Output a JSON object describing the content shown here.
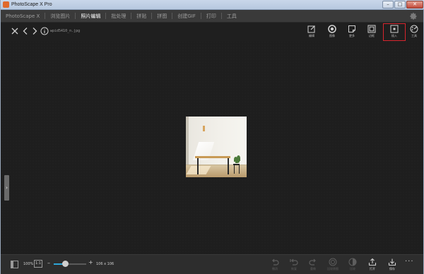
{
  "window": {
    "title": "PhotoScape X Pro",
    "controls": [
      "minimize",
      "maximize",
      "close"
    ]
  },
  "menu": {
    "items": [
      {
        "label": "PhotoScape X",
        "active": false
      },
      {
        "label": "浏览图片",
        "active": false
      },
      {
        "label": "照片编辑",
        "active": true
      },
      {
        "label": "批处理",
        "active": false
      },
      {
        "label": "拼贴",
        "active": false
      },
      {
        "label": "拼图",
        "active": false
      },
      {
        "label": "创建GIF",
        "active": false
      },
      {
        "label": "打印",
        "active": false
      },
      {
        "label": "工具",
        "active": false
      }
    ],
    "settings_icon": "gear-icon"
  },
  "toolbar": {
    "filename": "wpid5410_n.jpg",
    "tools": [
      {
        "label": "编辑",
        "icon": "edit-icon"
      },
      {
        "label": "图像",
        "icon": "filter-icon"
      },
      {
        "label": "更多",
        "icon": "more-icon"
      },
      {
        "label": "边框",
        "icon": "frame-icon"
      },
      {
        "label": "插入",
        "icon": "insert-icon"
      },
      {
        "label": "工具",
        "icon": "palette-icon"
      }
    ],
    "highlighted_tool": "插入",
    "highlight_color": "#d7252d"
  },
  "canvas": {
    "background": "#1e1e1e",
    "image_alt": "room with wooden table"
  },
  "statusbar": {
    "zoom_percent": "100%",
    "one_to_one": "1:1",
    "zoom_level": 0.35,
    "dimensions": "106 x 106",
    "accent": "#2da6d9",
    "actions": [
      {
        "label": "撤消",
        "icon": "undo-icon",
        "enabled": false
      },
      {
        "label": "恢复",
        "icon": "undo-all-icon",
        "enabled": false
      },
      {
        "label": "重做",
        "icon": "redo-icon",
        "enabled": false
      },
      {
        "label": "比较原图",
        "icon": "compare-icon",
        "enabled": false
      },
      {
        "label": "比较",
        "icon": "compare2-icon",
        "enabled": false
      },
      {
        "label": "打开",
        "icon": "open-icon",
        "enabled": true
      },
      {
        "label": "保存",
        "icon": "save-icon",
        "enabled": true
      }
    ],
    "more": "···"
  }
}
